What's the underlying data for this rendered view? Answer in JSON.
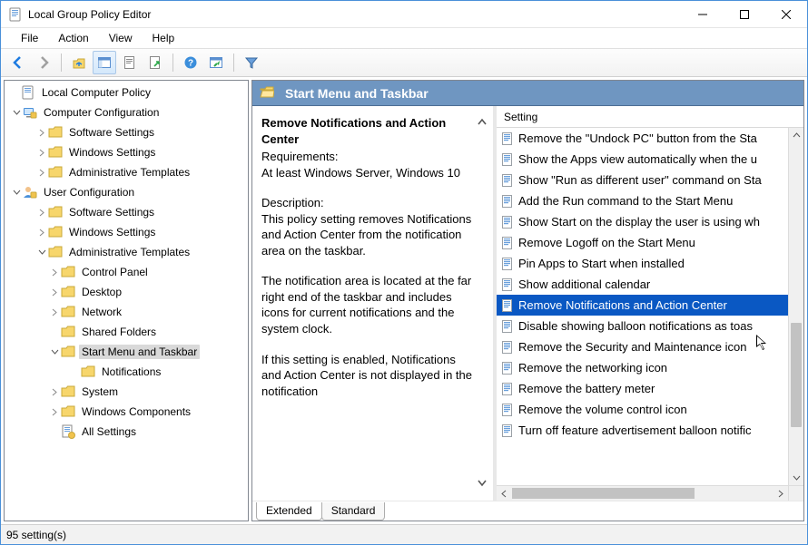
{
  "window": {
    "title": "Local Group Policy Editor"
  },
  "menu": {
    "items": [
      "File",
      "Action",
      "View",
      "Help"
    ]
  },
  "toolbar": {
    "buttons": [
      {
        "name": "back-icon",
        "color": "#1e7be0"
      },
      {
        "name": "forward-icon",
        "color": "#888888"
      },
      {
        "name": "up-icon",
        "color": "#1e7be0"
      },
      {
        "name": "options-icon",
        "color": "#1e7be0",
        "active": true
      },
      {
        "name": "show-hide-icon",
        "color": "#1e7be0"
      },
      {
        "name": "export-icon",
        "color": "#2da84b"
      }
    ],
    "buttons2": [
      {
        "name": "help-icon",
        "color": "#1e7be0"
      },
      {
        "name": "run-icon",
        "color": "#1e7be0"
      }
    ],
    "buttons3": [
      {
        "name": "filter-icon",
        "color": "#1e7be0"
      }
    ]
  },
  "tree": {
    "root": {
      "label": "Local Computer Policy"
    },
    "computerConfig": {
      "label": "Computer Configuration"
    },
    "ccSoftware": {
      "label": "Software Settings"
    },
    "ccWindows": {
      "label": "Windows Settings"
    },
    "ccAdmin": {
      "label": "Administrative Templates"
    },
    "userConfig": {
      "label": "User Configuration"
    },
    "ucSoftware": {
      "label": "Software Settings"
    },
    "ucWindows": {
      "label": "Windows Settings"
    },
    "ucAdmin": {
      "label": "Administrative Templates"
    },
    "controlPanel": {
      "label": "Control Panel"
    },
    "desktop": {
      "label": "Desktop"
    },
    "network": {
      "label": "Network"
    },
    "sharedFolders": {
      "label": "Shared Folders"
    },
    "startMenu": {
      "label": "Start Menu and Taskbar"
    },
    "notifications": {
      "label": "Notifications"
    },
    "system": {
      "label": "System"
    },
    "windowsComp": {
      "label": "Windows Components"
    },
    "allSettings": {
      "label": "All Settings"
    }
  },
  "rightHeader": {
    "title": "Start Menu and Taskbar"
  },
  "description": {
    "policyName": "Remove Notifications and Action Center",
    "reqLabel": "Requirements:",
    "reqValue": "At least Windows Server, Windows 10",
    "descLabel": "Description:",
    "descPara1": "This policy setting removes Notifications and Action Center from the notification area on the taskbar.",
    "descPara2": "The notification area is located at the far right end of the taskbar and includes icons for current notifications and the system clock.",
    "descPara3": "If this setting is enabled, Notifications and Action Center is not displayed in the notification"
  },
  "listHeader": "Setting",
  "settings": [
    "Remove the \"Undock PC\" button from the Sta",
    "Show the Apps view automatically when the u",
    "Show \"Run as different user\" command on Sta",
    "Add the Run command to the Start Menu",
    "Show Start on the display the user is using wh",
    "Remove Logoff on the Start Menu",
    "Pin Apps to Start when installed",
    "Show additional calendar",
    "Remove Notifications and Action Center",
    "Disable showing balloon notifications as toas",
    "Remove the Security and Maintenance icon",
    "Remove the networking icon",
    "Remove the battery meter",
    "Remove the volume control icon",
    "Turn off feature advertisement balloon notific"
  ],
  "selectedSettingIndex": 8,
  "tabs": {
    "extended": "Extended",
    "standard": "Standard"
  },
  "status": "95 setting(s)"
}
